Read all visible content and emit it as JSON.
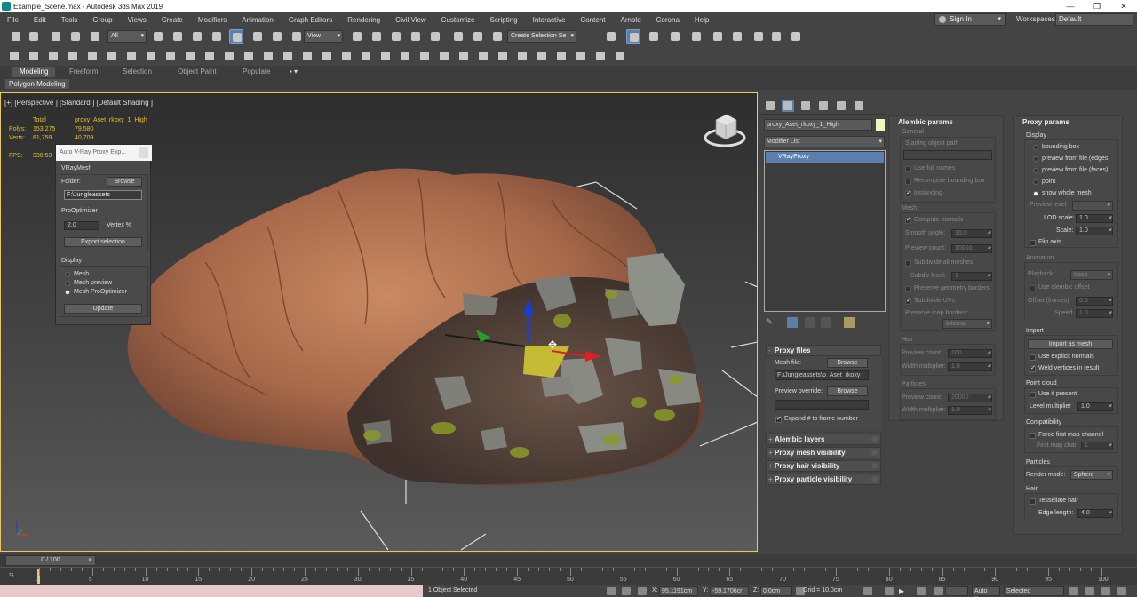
{
  "window": {
    "title": "Example_Scene.max - Autodesk 3ds Max 2019"
  },
  "menu": [
    "File",
    "Edit",
    "Tools",
    "Group",
    "Views",
    "Create",
    "Modifiers",
    "Animation",
    "Graph Editors",
    "Rendering",
    "Civil View",
    "Customize",
    "Scripting",
    "Interactive",
    "Content",
    "Arnold",
    "Corona",
    "Help"
  ],
  "account": {
    "sign_in": "Sign In",
    "workspaces_label": "Workspaces:",
    "workspace": "Default"
  },
  "toolbar": {
    "selection_filter": "All",
    "ref_coord": "View",
    "named_selection": "Create Selection Se"
  },
  "ribbon": {
    "tabs": [
      "Modeling",
      "Freeform",
      "Selection",
      "Object Paint",
      "Populate"
    ],
    "active_tab": "Modeling",
    "panel": "Polygon Modeling"
  },
  "viewport": {
    "label": "[+] [Perspective ] [Standard ] [Default Shading ]",
    "stats": {
      "header_total": "Total",
      "header_object": "proxy_Aset_rkoxy_1_High",
      "polys_label": "Polys:",
      "polys_total": "153,275",
      "polys_object": "79,580",
      "verts_label": "Verts:",
      "verts_total": "81,759",
      "verts_object": "40,709",
      "fps_label": "FPS:",
      "fps_value": "330.53"
    }
  },
  "vray_window": {
    "title": "Auto V-Ray Proxy Exp...",
    "section": "VRayMesh",
    "folder_label": "Folder:",
    "browse": "Browse",
    "folder_value": "F:\\Jungleassets",
    "prooptimizer": "ProOptimizer",
    "vertex_value": "2.0",
    "vertex_label": "Vertex %",
    "export": "Export selection",
    "display": "Display",
    "radio_mesh": "Mesh",
    "radio_preview": "Mesh preview",
    "radio_pro": "Mesh ProOptimizer",
    "update": "Update"
  },
  "command_panel": {
    "object_name": "proxy_Aset_rkoxy_1_High",
    "modifier_list": "Modifier List",
    "stack_item": "VRayProxy",
    "proxy_files": {
      "title": "Proxy files",
      "mesh_file": "Mesh file:",
      "browse": "Browse",
      "path": "F:\\Jungleassets\\p_Aset_rkoxy",
      "preview_override": "Preview override:",
      "browse2": "Browse",
      "expand": "Expand # to frame number"
    },
    "rollouts": [
      "Alembic layers",
      "Proxy mesh visibility",
      "Proxy hair visibility",
      "Proxy particle visibility"
    ]
  },
  "alembic": {
    "title": "Alembic params",
    "general": "General",
    "start_path": "Starting object path",
    "use_full_names": "Use full names",
    "recompute": "Recompute bounding box",
    "instancing": "Instancing",
    "mesh": "Mesh",
    "compute_normals": "Compute normals",
    "smooth_angle_label": "Smooth angle:",
    "smooth_angle": "30.0",
    "preview_count_label": "Preview count:",
    "preview_count": "10000",
    "subdivide_all": "Subdivide all meshes",
    "subdiv_level_label": "Subdiv level:",
    "subdiv_level": "1",
    "preserve_geo": "Preserve geometry borders",
    "subdivide_uvs": "Subdivide UVs",
    "preserve_map": "Preserve map borders:",
    "preserve_map_value": "Internal",
    "hair": "Hair",
    "hair_count_label": "Preview count:",
    "hair_count": "100",
    "width_mult_label": "Width multiplier:",
    "width_mult": "1.0",
    "particles": "Particles",
    "part_count_label": "Preview count:",
    "part_count": "20000",
    "part_width_label": "Width multiplier:",
    "part_width": "1.0"
  },
  "proxy_params": {
    "title": "Proxy params",
    "display": "Display",
    "opt_bbox": "bounding box",
    "opt_edges": "preview from file (edges",
    "opt_faces": "preview from file (faces)",
    "opt_point": "point",
    "opt_whole": "show whole mesh",
    "preview_level": "Preview level:",
    "lod_label": "LOD scale:",
    "lod": "1.0",
    "scale_label": "Scale:",
    "scale": "1.0",
    "flip": "Flip axis",
    "animation": "Animation",
    "playback_label": "Playback",
    "playback": "Loop",
    "use_alembic_offset": "Use alembic offset",
    "offset_label": "Offset (frames)",
    "offset": "0.0",
    "speed_label": "Speed",
    "speed": "1.0",
    "import": "Import",
    "import_as_mesh": "Import as mesh",
    "explicit_normals": "Use explicit normals",
    "weld": "Weld vertices in result",
    "point_cloud": "Point cloud",
    "use_if_present": "Use if present",
    "level_mult_label": "Level multiplier",
    "level_mult": "1.0",
    "compat": "Compatibility",
    "force_first": "Force first map channel",
    "first_map_label": "First map chan",
    "first_map": "1",
    "particles": "Particles",
    "render_mode_label": "Render mode:",
    "render_mode": "Sphere",
    "hair": "Hair",
    "tessellate": "Tessellate hair",
    "edge_length_label": "Edge length:",
    "edge_length": "4.0"
  },
  "timeline": {
    "frame": "0 / 100",
    "ticks": [
      "0",
      "5",
      "10",
      "15",
      "20",
      "25",
      "30",
      "35",
      "40",
      "45",
      "50",
      "55",
      "60",
      "65",
      "70",
      "75",
      "80",
      "85",
      "90",
      "95",
      "100"
    ]
  },
  "status": {
    "selected": "1 Object Selected",
    "x_label": "X:",
    "x": "95.1191cm",
    "y_label": "Y:",
    "y": "-59.1706cr",
    "z_label": "Z:",
    "z": "0.0cm",
    "grid": "Grid = 10.0cm",
    "autokey": "Auto Key",
    "selected_drop": "Selected"
  }
}
